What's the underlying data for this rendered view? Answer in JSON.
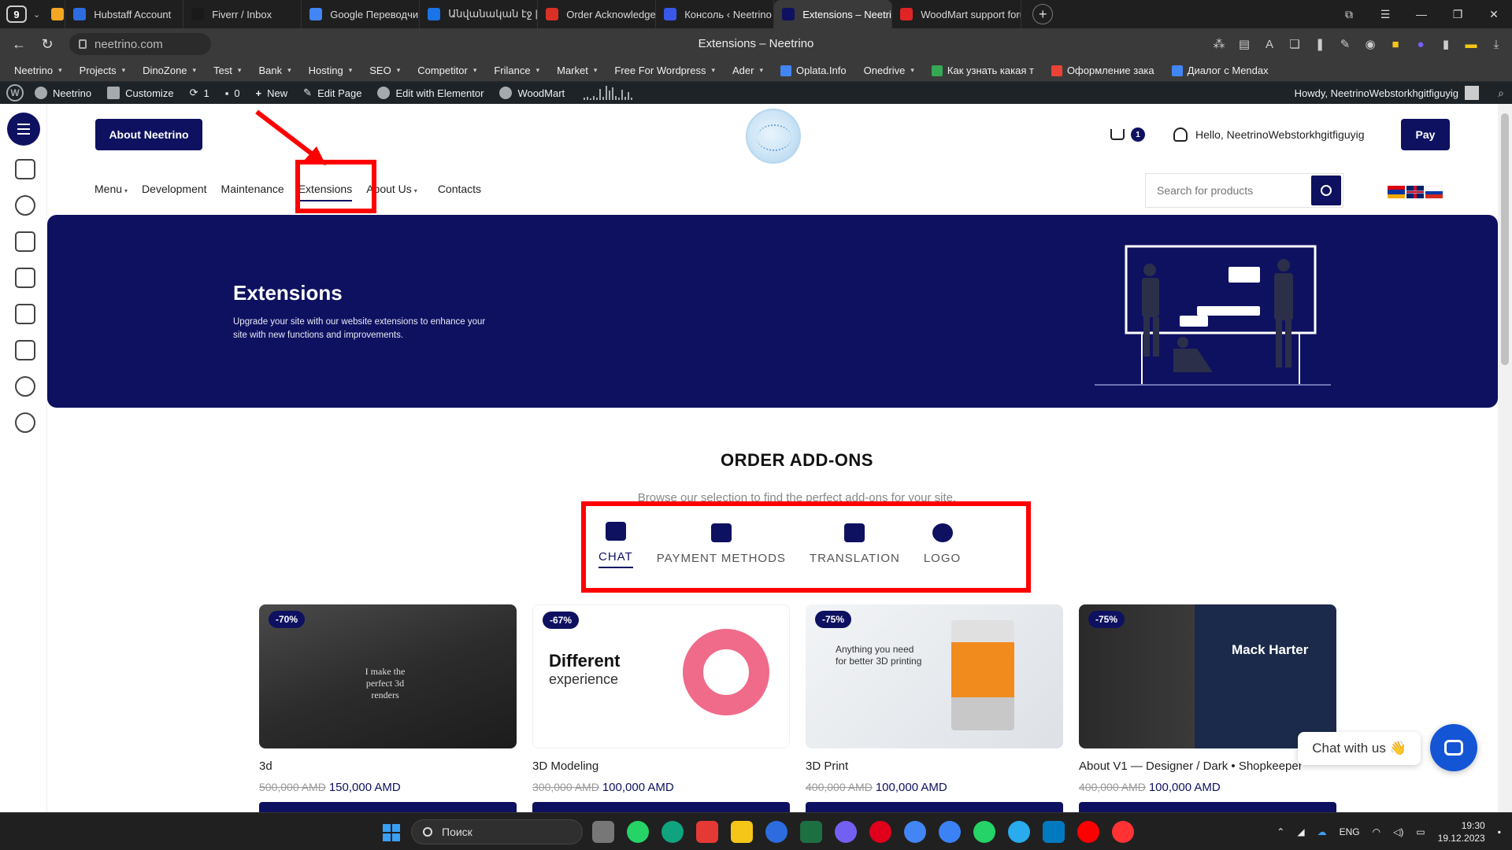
{
  "browser": {
    "tab_count": "9",
    "tabs": [
      {
        "label": "Hubstaff Account",
        "color": "#2d6cdf"
      },
      {
        "label": "Fiverr / Inbox",
        "color": "#1a1a1a"
      },
      {
        "label": "Google Переводчик",
        "color": "#4285f4"
      },
      {
        "label": "Անվանական էջ | Name...",
        "color": "#1a73e8"
      },
      {
        "label": "Order Acknowledgemen",
        "color": "#d93025"
      },
      {
        "label": "Консоль ‹ Neetrino — W",
        "color": "#3858e9"
      },
      {
        "label": "Extensions – Neetrino",
        "color": "#0e1160"
      },
      {
        "label": "WoodMart support foru",
        "color": "#e02424"
      }
    ],
    "active_tab_index": 6,
    "url": "neetrino.com",
    "page_title": "Extensions – Neetrino",
    "bookmarks": [
      {
        "label": "Neetrino",
        "dropdown": true
      },
      {
        "label": "Projects",
        "dropdown": true
      },
      {
        "label": "DinoZone",
        "dropdown": true
      },
      {
        "label": "Test",
        "dropdown": true
      },
      {
        "label": "Bank",
        "dropdown": true
      },
      {
        "label": "Hosting",
        "dropdown": true
      },
      {
        "label": "SEO",
        "dropdown": true
      },
      {
        "label": "Competitor",
        "dropdown": true
      },
      {
        "label": "Frilance",
        "dropdown": true
      },
      {
        "label": "Market",
        "dropdown": true
      },
      {
        "label": "Free For Wordpress",
        "dropdown": true
      },
      {
        "label": "Ader",
        "dropdown": true
      },
      {
        "label": "Oplata.Info",
        "dropdown": false
      },
      {
        "label": "Onedrive",
        "dropdown": true
      },
      {
        "label": "Как узнать какая т",
        "dropdown": false
      },
      {
        "label": "Оформление зака",
        "dropdown": false
      },
      {
        "label": "Диалог с Mendax",
        "dropdown": false
      }
    ]
  },
  "wpbar": {
    "site": "Neetrino",
    "customize": "Customize",
    "updates": "1",
    "comments": "0",
    "new": "New",
    "edit_page": "Edit Page",
    "elementor": "Edit with Elementor",
    "woodmart": "WoodMart",
    "howdy": "Howdy, NeetrinoWebstorkhgitfiguyig"
  },
  "header": {
    "about_button": "About Neetrino",
    "cart_count": "1",
    "user_greeting": "Hello, NeetrinoWebstorkhgitfiguyig",
    "pay_button": "Pay",
    "nav": [
      {
        "label": "Menu",
        "dropdown": true
      },
      {
        "label": "Development",
        "dropdown": false
      },
      {
        "label": "Maintenance",
        "dropdown": false
      },
      {
        "label": "Extensions",
        "dropdown": false,
        "active": true
      },
      {
        "label": "About Us",
        "dropdown": true
      },
      {
        "label": "Contacts",
        "dropdown": false
      }
    ],
    "search_placeholder": "Search for products"
  },
  "hero": {
    "title": "Extensions",
    "description": "Upgrade your site with our website extensions to enhance your site with new functions and improvements."
  },
  "addons": {
    "title": "ORDER ADD-ONS",
    "subtitle": "Browse our selection to find the perfect add-ons for your site.",
    "tabs": [
      {
        "label": "CHAT",
        "icon": "chat-icon",
        "active": true
      },
      {
        "label": "PAYMENT METHODS",
        "icon": "payment-icon",
        "active": false
      },
      {
        "label": "TRANSLATION",
        "icon": "translation-icon",
        "active": false
      },
      {
        "label": "LOGO",
        "icon": "globe-icon",
        "active": false
      }
    ]
  },
  "products": [
    {
      "name": "3d",
      "badge": "-70%",
      "old_price": "500,000 AMD",
      "price": "150,000 AMD",
      "thumb_text": "I make the perfect 3d renders"
    },
    {
      "name": "3D Modeling",
      "badge": "-67%",
      "old_price": "300,000 AMD",
      "price": "100,000 AMD",
      "thumb_text": "Different",
      "thumb_text2": "experience"
    },
    {
      "name": "3D Print",
      "badge": "-75%",
      "old_price": "400,000 AMD",
      "price": "100,000 AMD",
      "thumb_text": "Anything you need",
      "thumb_text2": "for better 3D printing"
    },
    {
      "name": "About V1 — Designer / Dark • Shopkeeper",
      "badge": "-75%",
      "old_price": "400,000 AMD",
      "price": "100,000 AMD",
      "thumb_text": "Mack Harter"
    }
  ],
  "chat": {
    "label": "Chat with us 👋"
  },
  "taskbar": {
    "search": "Поиск",
    "lang": "ENG",
    "time": "19:30",
    "date": "19.12.2023"
  },
  "colors": {
    "brand": "#0e1160",
    "annotation": "#ff0000",
    "chat_fab": "#1455d6"
  }
}
